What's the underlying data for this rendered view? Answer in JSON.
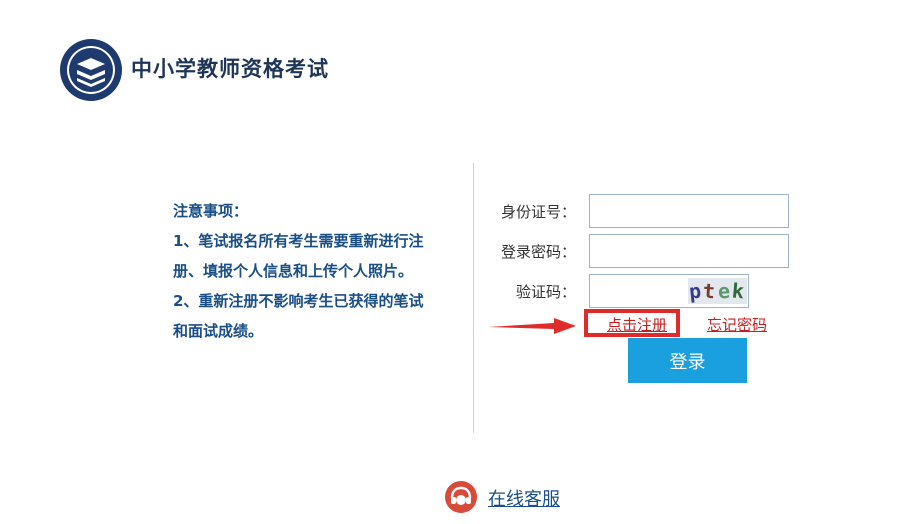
{
  "header": {
    "title": "中小学教师资格考试"
  },
  "notice": {
    "heading": "注意事项：",
    "line1": "1、笔试报名所有考生需要重新进行注",
    "line2": "册、填报个人信息和上传个人照片。",
    "line3": "2、重新注册不影响考生已获得的笔试",
    "line4": "和面试成绩。"
  },
  "form": {
    "id_label": "身份证号：",
    "id_value": "",
    "password_label": "登录密码：",
    "password_value": "",
    "captcha_label": "验证码：",
    "captcha_value": "",
    "captcha_chars": [
      "p",
      "t",
      "e",
      "k"
    ],
    "captcha_colors": [
      "#3a3a8c",
      "#7a3b2e",
      "#5a9a6a",
      "#2d6b3a"
    ],
    "register_link": "点击注册",
    "forgot_link": "忘记密码",
    "login_button": "登录"
  },
  "footer": {
    "service_link": "在线客服"
  },
  "colors": {
    "brand_navy": "#1e3557",
    "notice_blue": "#1a4f86",
    "link_red": "#c81e1e",
    "highlight_red": "#e02b2b",
    "button_blue": "#1a9fdf",
    "service_icon_red": "#d84a3a"
  }
}
